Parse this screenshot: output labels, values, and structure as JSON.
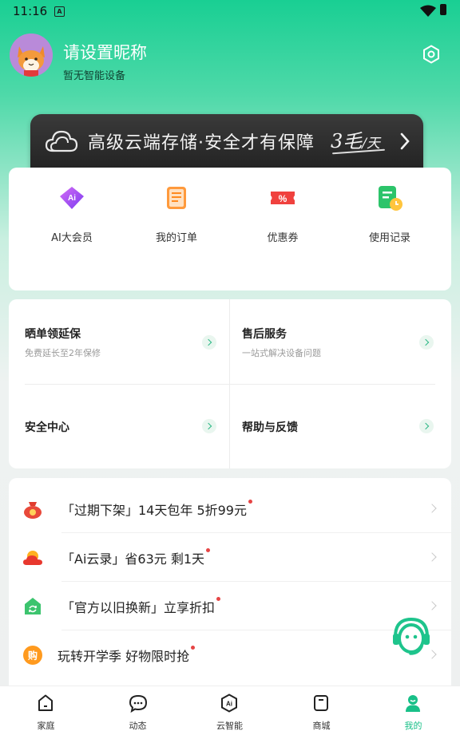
{
  "status_bar": {
    "time": "11:16",
    "notification_icon": "A"
  },
  "profile": {
    "nickname": "请设置昵称",
    "device_hint": "暂无智能设备"
  },
  "banner": {
    "text": "高级云端存储·安全才有保障",
    "price_main": "3毛",
    "price_unit": "/天"
  },
  "quick_actions": [
    {
      "label": "AI大会员",
      "icon": "ai-diamond-icon"
    },
    {
      "label": "我的订单",
      "icon": "order-list-icon"
    },
    {
      "label": "优惠券",
      "icon": "coupon-icon"
    },
    {
      "label": "使用记录",
      "icon": "usage-record-icon"
    }
  ],
  "services": [
    {
      "title": "晒单领延保",
      "subtitle": "免费延长至2年保修"
    },
    {
      "title": "售后服务",
      "subtitle": "一站式解决设备问题"
    },
    {
      "title": "安全中心",
      "subtitle": ""
    },
    {
      "title": "帮助与反馈",
      "subtitle": ""
    }
  ],
  "promotions": [
    {
      "text": "「过期下架」14天包年 5折99元",
      "icon": "red-pouch-icon"
    },
    {
      "text": "「Ai云录」省63元 剩1天",
      "icon": "red-cloud-icon"
    },
    {
      "text": "「官方以旧换新」立享折扣",
      "icon": "green-house-icon"
    },
    {
      "text": "玩转开学季 好物限时抢",
      "icon": "orange-buy-icon",
      "icon_text": "购"
    }
  ],
  "tabs": [
    {
      "label": "家庭",
      "active": false
    },
    {
      "label": "动态",
      "active": false
    },
    {
      "label": "云智能",
      "active": false
    },
    {
      "label": "商城",
      "active": false
    },
    {
      "label": "我的",
      "active": true
    }
  ],
  "colors": {
    "accent": "#18c088",
    "header_top": "#19cf93",
    "banner_bg": "#2a2a2a",
    "promo_dot": "#e64545"
  }
}
